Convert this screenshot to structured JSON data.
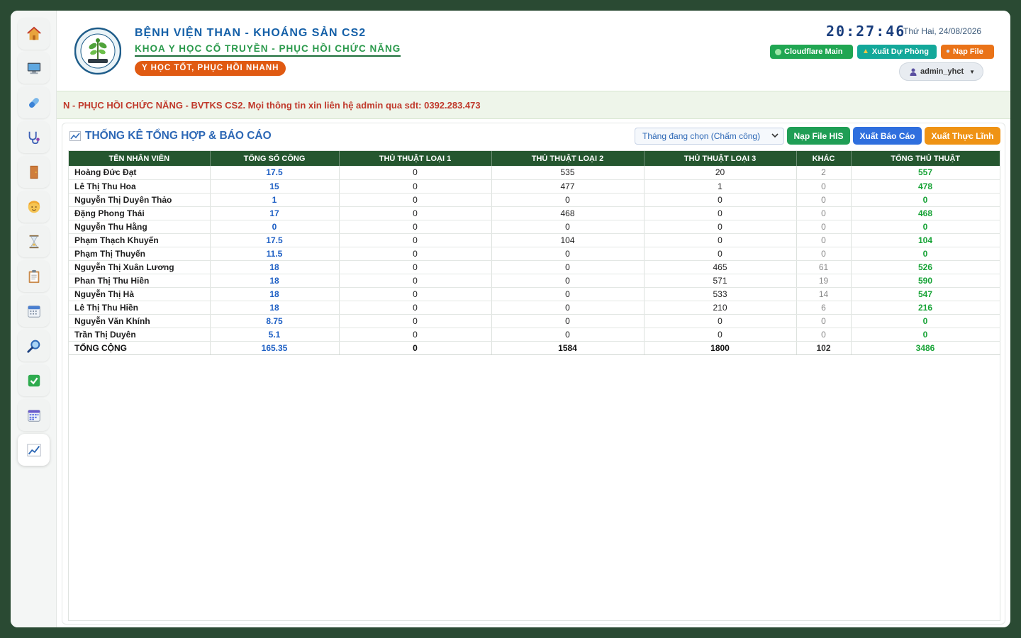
{
  "header": {
    "hospital_name": "BỆNH VIỆN THAN - KHOÁNG SẢN CS2",
    "department": "KHOA Y HỌC CỔ TRUYỀN - PHỤC HỒI CHỨC NĂNG",
    "slogan": "Y HỌC TỐT, PHỤC HỒI NHANH",
    "clock": "20:27:46",
    "date": "Thứ Hai, 24/08/2026",
    "buttons": {
      "cloudflare": "Cloudflare Main",
      "backup": "Xuất Dự Phòng",
      "load_file": "Nạp File"
    },
    "user": "admin_yhct"
  },
  "marquee": "N - PHỤC HỒI CHỨC NĂNG - BVTKS CS2. Mọi thông tin xin liên hệ admin qua sdt: 0392.283.473",
  "sidebar": {
    "items": [
      "home-icon",
      "monitor-icon",
      "pill-icon",
      "stethoscope-icon",
      "door-icon",
      "person-icon",
      "hourglass-icon",
      "clipboard-icon",
      "calendar-icon",
      "search-icon",
      "checkbox-icon",
      "calendar-grid-icon",
      "chart-line-icon"
    ],
    "active": "chart-line-icon"
  },
  "report": {
    "title": "THỐNG KÊ TỔNG HỢP & BÁO CÁO",
    "month_select": "Tháng đang chọn (Chấm công)",
    "btn_his": "Nạp File HIS",
    "btn_export": "Xuất Báo Cáo",
    "btn_actual": "Xuất Thực Lĩnh",
    "columns": [
      "TÊN NHÂN VIÊN",
      "TỔNG SỐ CÔNG",
      "THỦ THUẬT LOẠI 1",
      "THỦ THUẬT LOẠI 2",
      "THỦ THUẬT LOẠI 3",
      "KHÁC",
      "TỔNG THỦ THUẬT"
    ],
    "rows": [
      [
        "Hoàng Đức Đạt",
        "17.5",
        "0",
        "535",
        "20",
        "2",
        "557"
      ],
      [
        "Lê Thị Thu Hoa",
        "15",
        "0",
        "477",
        "1",
        "0",
        "478"
      ],
      [
        "Nguyễn Thị Duyên Thảo",
        "1",
        "0",
        "0",
        "0",
        "0",
        "0"
      ],
      [
        "Đặng Phong Thái",
        "17",
        "0",
        "468",
        "0",
        "0",
        "468"
      ],
      [
        "Nguyễn Thu Hằng",
        "0",
        "0",
        "0",
        "0",
        "0",
        "0"
      ],
      [
        "Phạm Thạch Khuyến",
        "17.5",
        "0",
        "104",
        "0",
        "0",
        "104"
      ],
      [
        "Phạm Thị Thuyến",
        "11.5",
        "0",
        "0",
        "0",
        "0",
        "0"
      ],
      [
        "Nguyễn Thị Xuân Lương",
        "18",
        "0",
        "0",
        "465",
        "61",
        "526"
      ],
      [
        "Phan Thị Thu Hiền",
        "18",
        "0",
        "0",
        "571",
        "19",
        "590"
      ],
      [
        "Nguyễn Thị Hà",
        "18",
        "0",
        "0",
        "533",
        "14",
        "547"
      ],
      [
        "Lê Thị Thu Hiền",
        "18",
        "0",
        "0",
        "210",
        "6",
        "216"
      ],
      [
        "Nguyễn Văn Khính",
        "8.75",
        "0",
        "0",
        "0",
        "0",
        "0"
      ],
      [
        "Trần Thị Duyên",
        "5.1",
        "0",
        "0",
        "0",
        "0",
        "0"
      ]
    ],
    "total": [
      "TỔNG CỘNG",
      "165.35",
      "0",
      "1584",
      "1800",
      "102",
      "3486"
    ]
  }
}
